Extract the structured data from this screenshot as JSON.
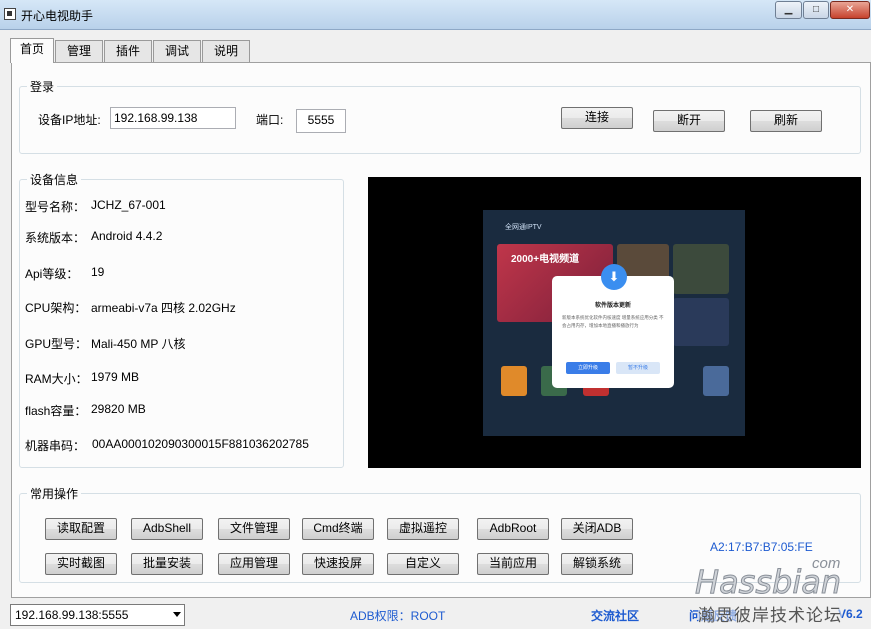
{
  "window": {
    "title": "开心电视助手",
    "icon": "app-window-icon",
    "controls": [
      "minimize-icon",
      "maximize-icon",
      "close-icon"
    ]
  },
  "tabs": [
    {
      "label": "首页",
      "active": true
    },
    {
      "label": "管理",
      "active": false
    },
    {
      "label": "插件",
      "active": false
    },
    {
      "label": "调试",
      "active": false
    },
    {
      "label": "说明",
      "active": false
    }
  ],
  "login": {
    "title": "登录",
    "ip_label": "设备IP地址:",
    "ip_value": "192.168.99.138",
    "port_label": "端口:",
    "port_value": "5555",
    "connect": "连接",
    "disconnect": "断开",
    "refresh": "刷新"
  },
  "device": {
    "title": "设备信息",
    "rows": [
      {
        "label": "型号名称：",
        "value": "JCHZ_67-001"
      },
      {
        "label": "系统版本：",
        "value": "Android 4.4.2"
      },
      {
        "label": "Api等级：",
        "value": "19"
      },
      {
        "label": "CPU架构：",
        "value": "armeabi-v7a 四核 2.02GHz"
      },
      {
        "label": "GPU型号：",
        "value": "Mali-450 MP 八核"
      },
      {
        "label": "RAM大小：",
        "value": "1979 MB"
      },
      {
        "label": "flash容量：",
        "value": "29820 MB"
      },
      {
        "label": "机器串码：",
        "value": "00AA000102090300015F881036202785"
      }
    ]
  },
  "screen_preview": {
    "app_name": "全网通IPTV",
    "banner": "2000+电视频道",
    "dialog_title": "软件版本更新",
    "dialog_body": "新版本系统优化软件内核速度 增量系统应用分类 不会占用内存，增加本地直播和播放行为",
    "dialog_ok": "立即升级",
    "dialog_cancel": "暂不升级"
  },
  "ops": {
    "title": "常用操作",
    "row1": [
      "读取配置",
      "AdbShell",
      "文件管理",
      "Cmd终端",
      "虚拟遥控",
      "AdbRoot",
      "关闭ADB"
    ],
    "row2": [
      "实时截图",
      "批量安装",
      "应用管理",
      "快速投屏",
      "自定义",
      "当前应用",
      "解锁系统"
    ],
    "mac": "A2:17:B7:B7:05:FE"
  },
  "statusbar": {
    "device_select": "192.168.99.138:5555",
    "adb_permission": "ADB权限：ROOT",
    "community": "交流社区",
    "feedback": "问题反馈",
    "version": "V6.2"
  },
  "watermark": {
    "brand": "Hassbian",
    "suffix": "com",
    "subtitle": "瀚思彼岸技术论坛"
  },
  "colors": {
    "link": "#1e5bd0",
    "titlebar": "#c4daf0",
    "watermark": "#8a9099"
  }
}
